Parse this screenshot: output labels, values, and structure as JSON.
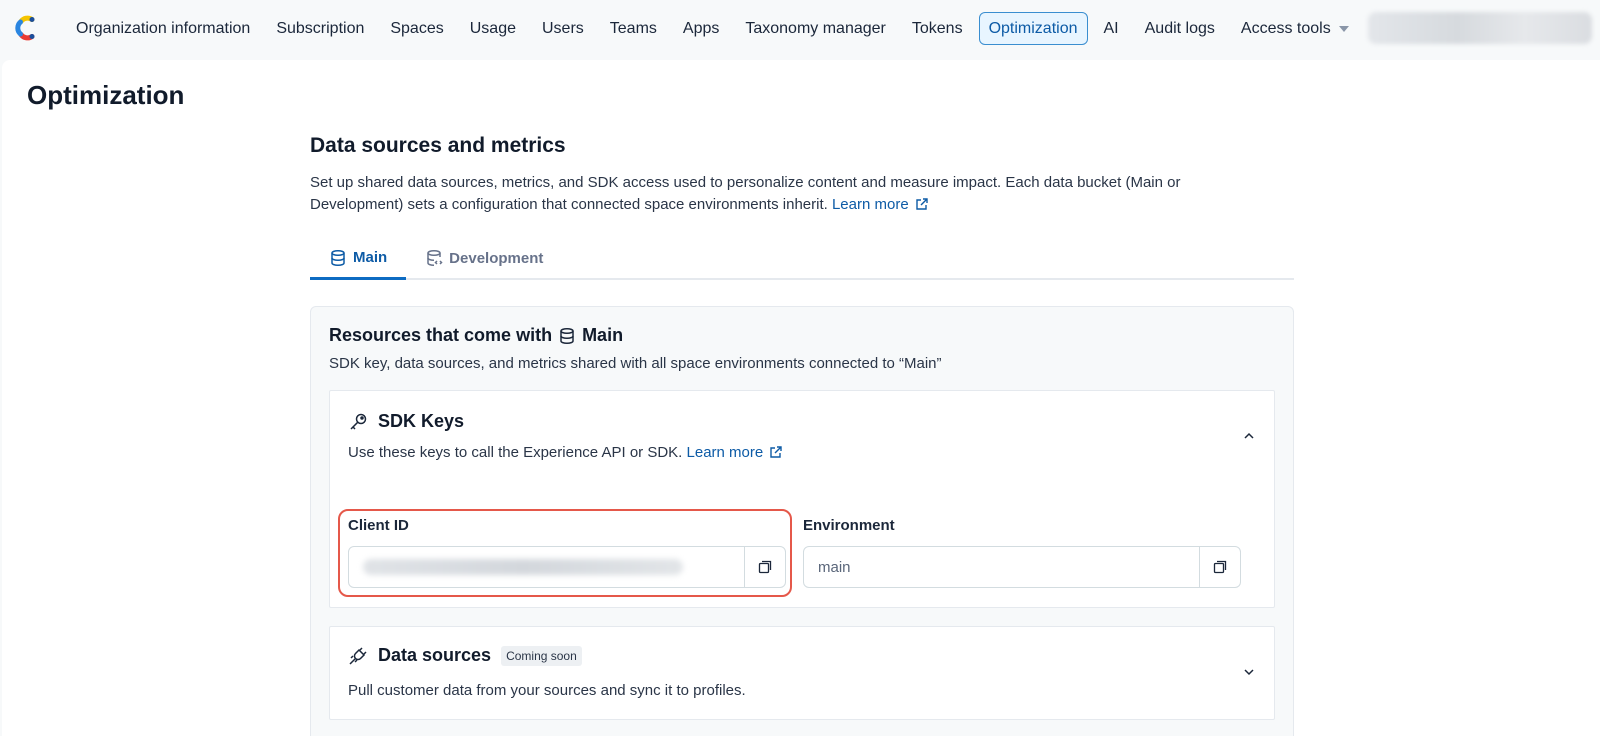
{
  "nav": {
    "items": [
      {
        "label": "Organization information"
      },
      {
        "label": "Subscription"
      },
      {
        "label": "Spaces"
      },
      {
        "label": "Usage"
      },
      {
        "label": "Users"
      },
      {
        "label": "Teams"
      },
      {
        "label": "Apps"
      },
      {
        "label": "Taxonomy manager"
      },
      {
        "label": "Tokens"
      },
      {
        "label": "Optimization",
        "active": true
      },
      {
        "label": "AI"
      },
      {
        "label": "Audit logs"
      },
      {
        "label": "Access tools",
        "dropdown": true
      }
    ]
  },
  "page": {
    "title": "Optimization"
  },
  "section": {
    "title": "Data sources and metrics",
    "description": "Set up shared data sources, metrics, and SDK access used to personalize content and measure impact. Each data bucket (Main or Development) sets a configuration that connected space environments inherit.",
    "learn_more": "Learn more"
  },
  "tabs": [
    {
      "label": "Main",
      "active": true
    },
    {
      "label": "Development",
      "active": false
    }
  ],
  "resources": {
    "title_prefix": "Resources that come with",
    "title_bucket": "Main",
    "description": "SDK key, data sources, and metrics shared with all space environments connected to “Main”"
  },
  "sdk_keys": {
    "title": "SDK Keys",
    "description": "Use these keys to call the Experience API or SDK.",
    "learn_more": "Learn more",
    "client_id": {
      "label": "Client ID",
      "value": ""
    },
    "environment": {
      "label": "Environment",
      "value": "main"
    }
  },
  "data_sources": {
    "title": "Data sources",
    "badge": "Coming soon",
    "description": "Pull customer data from your sources and sync it to profiles."
  },
  "colors": {
    "accent": "#0d5ba6",
    "highlight": "#e5584a"
  }
}
